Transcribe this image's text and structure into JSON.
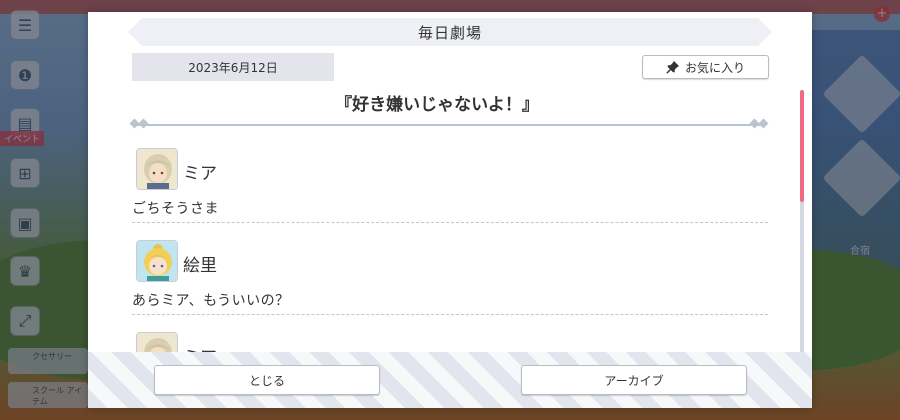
{
  "background": {
    "event_tag": "イベント",
    "bottom_buttons": [
      "クセサリー",
      "スクール\nアイテム"
    ],
    "top_right_text": "",
    "right_label": "合宿"
  },
  "dialog": {
    "header_title": "毎日劇場",
    "date": "2023年6月12日",
    "favorite_label": "お気に入り",
    "episode_title": "『好き嫌いじゃないよ！』",
    "messages": [
      {
        "speaker": "ミア",
        "text": "ごちそうさま",
        "avatar": "mia-avatar"
      },
      {
        "speaker": "絵里",
        "text": "あらミア、もういいの？",
        "avatar": "eli-avatar"
      },
      {
        "speaker": "ミア",
        "text": "",
        "avatar": "mia-avatar"
      }
    ],
    "close_label": "とじる",
    "archive_label": "アーカイブ"
  },
  "colors": {
    "accent_scroll": "#f06b82",
    "header_bg": "#eef0f6",
    "date_bg": "#e4e5ec"
  }
}
